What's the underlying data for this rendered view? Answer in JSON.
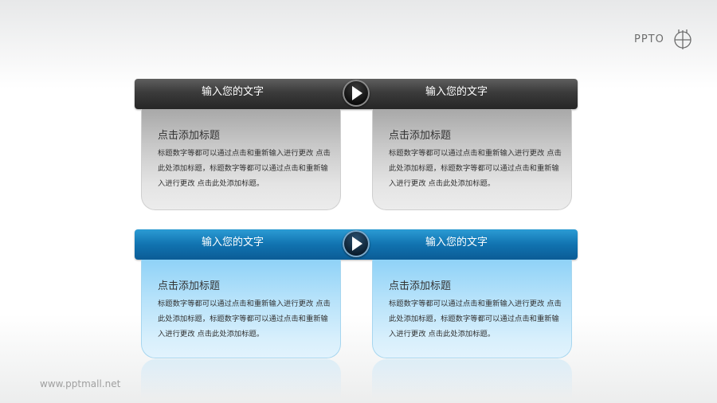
{
  "logo": {
    "text": "PPTO",
    "mark_icon": "globe-icon"
  },
  "rows": [
    {
      "style": "dark",
      "bar": {
        "left_label": "输入您的文字",
        "right_label": "输入您的文字",
        "center_icon": "play-icon"
      },
      "cards": [
        {
          "title": "点击添加标题",
          "body": "标题数字等都可以通过点击和重新输入进行更改 点击此处添加标题，标题数字等都可以通过点击和重新输入进行更改 点击此处添加标题。"
        },
        {
          "title": "点击添加标题",
          "body": "标题数字等都可以通过点击和重新输入进行更改 点击此处添加标题，标题数字等都可以通过点击和重新输入进行更改 点击此处添加标题。"
        }
      ]
    },
    {
      "style": "blue",
      "bar": {
        "left_label": "输入您的文字",
        "right_label": "输入您的文字",
        "center_icon": "play-icon"
      },
      "cards": [
        {
          "title": "点击添加标题",
          "body": "标题数字等都可以通过点击和重新输入进行更改 点击此处添加标题，标题数字等都可以通过点击和重新输入进行更改 点击此处添加标题。"
        },
        {
          "title": "点击添加标题",
          "body": "标题数字等都可以通过点击和重新输入进行更改 点击此处添加标题，标题数字等都可以通过点击和重新输入进行更改 点击此处添加标题。"
        }
      ]
    }
  ],
  "footer": {
    "url": "www.pptmall.net"
  },
  "colors": {
    "dark_bar": "#333333",
    "blue_bar": "#1173b0",
    "grey_card": "#c7c7c7",
    "light_blue_card": "#b6e2fa"
  }
}
